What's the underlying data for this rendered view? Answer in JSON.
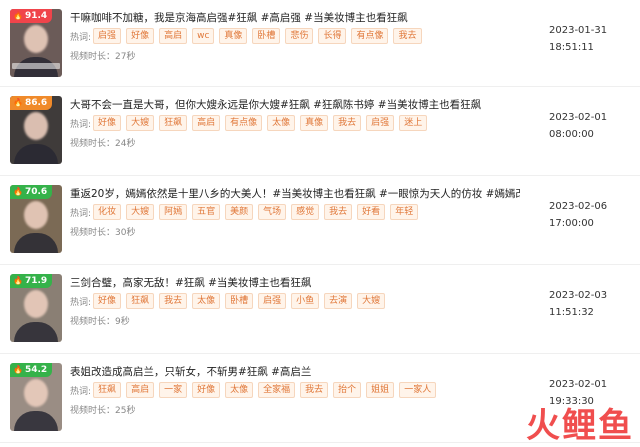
{
  "items": [
    {
      "score": "91.4",
      "badge_color": "#f0444b",
      "thumb_bg": "#6b5b58",
      "title": "干嘛咖啡不加糖，我是京海高启强#狂飙 #高启强 #当美妆博主也看狂飙",
      "hot_label": "热词:",
      "tags": [
        "启强",
        "好像",
        "高启",
        "wc",
        "真像",
        "卧槽",
        "悲伤",
        "长得",
        "有点像",
        "我去"
      ],
      "duration": "视频时长：27秒",
      "date": "2023-01-31",
      "time": "18:51:11"
    },
    {
      "score": "86.6",
      "badge_color": "#f08a2a",
      "thumb_bg": "#3f3b3a",
      "title": "大哥不会一直是大哥，但你大嫂永远是你大嫂#狂飙 #狂飙陈书婷 #当美妆博主也看狂飙",
      "hot_label": "热词:",
      "tags": [
        "好像",
        "大嫂",
        "狂飙",
        "高启",
        "有点像",
        "太像",
        "真像",
        "我去",
        "启强",
        "迷上"
      ],
      "duration": "视频时长：24秒",
      "date": "2023-02-01",
      "time": "08:00:00"
    },
    {
      "score": "70.6",
      "badge_color": "#35b24a",
      "thumb_bg": "#7b6a55",
      "title": "重返20岁，嫣嫣依然是十里八乡的大美人！#当美妆博主也看狂飙 #一眼惊为天人的仿妆 #嫣嫣改造",
      "hot_label": "热词:",
      "tags": [
        "化妆",
        "大嫂",
        "阿嫣",
        "五官",
        "美颜",
        "气场",
        "感觉",
        "我去",
        "好看",
        "年轻"
      ],
      "duration": "视频时长：30秒",
      "date": "2023-02-06",
      "time": "17:00:00"
    },
    {
      "score": "71.9",
      "badge_color": "#35b24a",
      "thumb_bg": "#8a7f74",
      "title": "三剑合璧，高家无敌！#狂飙 #当美妆博主也看狂飙",
      "hot_label": "热词:",
      "tags": [
        "好像",
        "狂飙",
        "我去",
        "太像",
        "卧槽",
        "启强",
        "小鱼",
        "去演",
        "大嫂"
      ],
      "duration": "视频时长：9秒",
      "date": "2023-02-03",
      "time": "11:51:32"
    },
    {
      "score": "54.2",
      "badge_color": "#35b24a",
      "thumb_bg": "#9a8d84",
      "title": "表姐改造成高启兰，只斩女，不斩男#狂飙 #高启兰",
      "hot_label": "热词:",
      "tags": [
        "狂飙",
        "高启",
        "一家",
        "好像",
        "太像",
        "全家福",
        "我去",
        "抬个",
        "姐姐",
        "一家人"
      ],
      "duration": "视频时长：25秒",
      "date": "2023-02-01",
      "time": "19:33:30"
    }
  ],
  "watermark": [
    "火",
    "鲤",
    "鱼"
  ]
}
